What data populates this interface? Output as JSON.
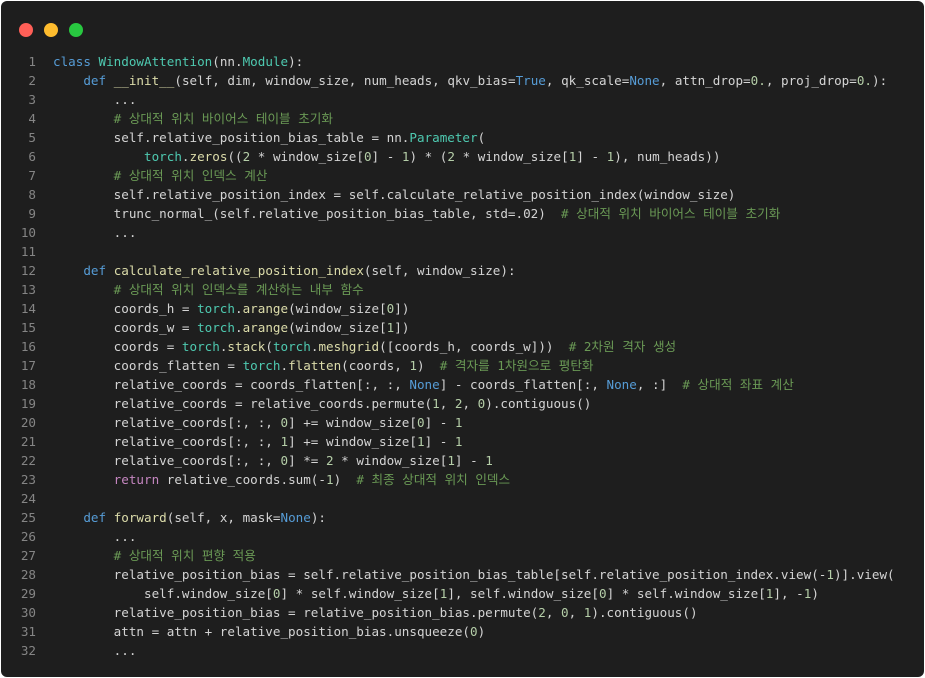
{
  "window": {
    "controls": [
      "close",
      "minimize",
      "maximize"
    ],
    "colors": {
      "close": "#ff5f57",
      "minimize": "#febc2e",
      "maximize": "#28c840",
      "background": "#1e1e1e"
    }
  },
  "language": "python",
  "lines": [
    {
      "n": "1",
      "tokens": [
        [
          "kw",
          "class "
        ],
        [
          "cls",
          "WindowAttention"
        ],
        [
          "pl",
          "(nn."
        ],
        [
          "cls",
          "Module"
        ],
        [
          "pl",
          "):"
        ]
      ]
    },
    {
      "n": "2",
      "tokens": [
        [
          "pl",
          "    "
        ],
        [
          "kw",
          "def "
        ],
        [
          "fn",
          "__init__"
        ],
        [
          "pl",
          "(self, dim, window_size, num_heads, qkv_bias="
        ],
        [
          "kw",
          "True"
        ],
        [
          "pl",
          ", qk_scale="
        ],
        [
          "kw",
          "None"
        ],
        [
          "pl",
          ", attn_drop="
        ],
        [
          "num",
          "0."
        ],
        [
          "pl",
          ", proj_drop="
        ],
        [
          "num",
          "0."
        ],
        [
          "pl",
          "):"
        ]
      ]
    },
    {
      "n": "3",
      "tokens": [
        [
          "pl",
          "        ..."
        ]
      ]
    },
    {
      "n": "4",
      "tokens": [
        [
          "pl",
          "        "
        ],
        [
          "cm",
          "# 상대적 위치 바이어스 테이블 초기화"
        ]
      ]
    },
    {
      "n": "5",
      "tokens": [
        [
          "pl",
          "        self.relative_position_bias_table = nn."
        ],
        [
          "cls",
          "Parameter"
        ],
        [
          "pl",
          "("
        ]
      ]
    },
    {
      "n": "6",
      "tokens": [
        [
          "pl",
          "            "
        ],
        [
          "cls",
          "torch"
        ],
        [
          "pl",
          "."
        ],
        [
          "fn",
          "zeros"
        ],
        [
          "pl",
          "(("
        ],
        [
          "num",
          "2"
        ],
        [
          "pl",
          " * window_size["
        ],
        [
          "num",
          "0"
        ],
        [
          "pl",
          "] - "
        ],
        [
          "num",
          "1"
        ],
        [
          "pl",
          ") * ("
        ],
        [
          "num",
          "2"
        ],
        [
          "pl",
          " * window_size["
        ],
        [
          "num",
          "1"
        ],
        [
          "pl",
          "] - "
        ],
        [
          "num",
          "1"
        ],
        [
          "pl",
          "), num_heads))"
        ]
      ]
    },
    {
      "n": "7",
      "tokens": [
        [
          "pl",
          "        "
        ],
        [
          "cm",
          "# 상대적 위치 인덱스 계산"
        ]
      ]
    },
    {
      "n": "8",
      "tokens": [
        [
          "pl",
          "        self.relative_position_index = self.calculate_relative_position_index(window_size)"
        ]
      ]
    },
    {
      "n": "9",
      "tokens": [
        [
          "pl",
          "        trunc_normal_(self.relative_position_bias_table, std=.02)  "
        ],
        [
          "cm",
          "# 상대적 위치 바이어스 테이블 초기화"
        ]
      ]
    },
    {
      "n": "10",
      "tokens": [
        [
          "pl",
          "        ..."
        ]
      ]
    },
    {
      "n": "11",
      "tokens": []
    },
    {
      "n": "12",
      "tokens": [
        [
          "pl",
          "    "
        ],
        [
          "kw",
          "def "
        ],
        [
          "fn",
          "calculate_relative_position_index"
        ],
        [
          "pl",
          "(self, window_size):"
        ]
      ]
    },
    {
      "n": "13",
      "tokens": [
        [
          "pl",
          "        "
        ],
        [
          "cm",
          "# 상대적 위치 인덱스를 계산하는 내부 함수"
        ]
      ]
    },
    {
      "n": "14",
      "tokens": [
        [
          "pl",
          "        coords_h = "
        ],
        [
          "cls",
          "torch"
        ],
        [
          "pl",
          "."
        ],
        [
          "fn",
          "arange"
        ],
        [
          "pl",
          "(window_size["
        ],
        [
          "num",
          "0"
        ],
        [
          "pl",
          "])"
        ]
      ]
    },
    {
      "n": "15",
      "tokens": [
        [
          "pl",
          "        coords_w = "
        ],
        [
          "cls",
          "torch"
        ],
        [
          "pl",
          "."
        ],
        [
          "fn",
          "arange"
        ],
        [
          "pl",
          "(window_size["
        ],
        [
          "num",
          "1"
        ],
        [
          "pl",
          "])"
        ]
      ]
    },
    {
      "n": "16",
      "tokens": [
        [
          "pl",
          "        coords = "
        ],
        [
          "cls",
          "torch"
        ],
        [
          "pl",
          "."
        ],
        [
          "fn",
          "stack"
        ],
        [
          "pl",
          "("
        ],
        [
          "cls",
          "torch"
        ],
        [
          "pl",
          "."
        ],
        [
          "fn",
          "meshgrid"
        ],
        [
          "pl",
          "([coords_h, coords_w]))  "
        ],
        [
          "cm",
          "# 2차원 격자 생성"
        ]
      ]
    },
    {
      "n": "17",
      "tokens": [
        [
          "pl",
          "        coords_flatten = "
        ],
        [
          "cls",
          "torch"
        ],
        [
          "pl",
          "."
        ],
        [
          "fn",
          "flatten"
        ],
        [
          "pl",
          "(coords, "
        ],
        [
          "num",
          "1"
        ],
        [
          "pl",
          ")  "
        ],
        [
          "cm",
          "# 격자를 1차원으로 평탄화"
        ]
      ]
    },
    {
      "n": "18",
      "tokens": [
        [
          "pl",
          "        relative_coords = coords_flatten[:, :, "
        ],
        [
          "kw",
          "None"
        ],
        [
          "pl",
          "] - coords_flatten[:, "
        ],
        [
          "kw",
          "None"
        ],
        [
          "pl",
          ", :]  "
        ],
        [
          "cm",
          "# 상대적 좌표 계산"
        ]
      ]
    },
    {
      "n": "19",
      "tokens": [
        [
          "pl",
          "        relative_coords = relative_coords.permute("
        ],
        [
          "num",
          "1"
        ],
        [
          "pl",
          ", "
        ],
        [
          "num",
          "2"
        ],
        [
          "pl",
          ", "
        ],
        [
          "num",
          "0"
        ],
        [
          "pl",
          ").contiguous()"
        ]
      ]
    },
    {
      "n": "20",
      "tokens": [
        [
          "pl",
          "        relative_coords[:, :, "
        ],
        [
          "num",
          "0"
        ],
        [
          "pl",
          "] += window_size["
        ],
        [
          "num",
          "0"
        ],
        [
          "pl",
          "] - "
        ],
        [
          "num",
          "1"
        ]
      ]
    },
    {
      "n": "21",
      "tokens": [
        [
          "pl",
          "        relative_coords[:, :, "
        ],
        [
          "num",
          "1"
        ],
        [
          "pl",
          "] += window_size["
        ],
        [
          "num",
          "1"
        ],
        [
          "pl",
          "] - "
        ],
        [
          "num",
          "1"
        ]
      ]
    },
    {
      "n": "22",
      "tokens": [
        [
          "pl",
          "        relative_coords[:, :, "
        ],
        [
          "num",
          "0"
        ],
        [
          "pl",
          "] *= "
        ],
        [
          "num",
          "2"
        ],
        [
          "pl",
          " * window_size["
        ],
        [
          "num",
          "1"
        ],
        [
          "pl",
          "] - "
        ],
        [
          "num",
          "1"
        ]
      ]
    },
    {
      "n": "23",
      "tokens": [
        [
          "pl",
          "        "
        ],
        [
          "ret",
          "return "
        ],
        [
          "pl",
          "relative_coords.sum(-"
        ],
        [
          "num",
          "1"
        ],
        [
          "pl",
          ")  "
        ],
        [
          "cm",
          "# 최종 상대적 위치 인덱스"
        ]
      ]
    },
    {
      "n": "24",
      "tokens": []
    },
    {
      "n": "25",
      "tokens": [
        [
          "pl",
          "    "
        ],
        [
          "kw",
          "def "
        ],
        [
          "fn",
          "forward"
        ],
        [
          "pl",
          "(self, x, mask="
        ],
        [
          "kw",
          "None"
        ],
        [
          "pl",
          "):"
        ]
      ]
    },
    {
      "n": "26",
      "tokens": [
        [
          "pl",
          "        ..."
        ]
      ]
    },
    {
      "n": "27",
      "tokens": [
        [
          "pl",
          "        "
        ],
        [
          "cm",
          "# 상대적 위치 편향 적용"
        ]
      ]
    },
    {
      "n": "28",
      "tokens": [
        [
          "pl",
          "        relative_position_bias = self.relative_position_bias_table[self.relative_position_index.view(-"
        ],
        [
          "num",
          "1"
        ],
        [
          "pl",
          ")].view("
        ]
      ]
    },
    {
      "n": "29",
      "tokens": [
        [
          "pl",
          "            self.window_size["
        ],
        [
          "num",
          "0"
        ],
        [
          "pl",
          "] * self.window_size["
        ],
        [
          "num",
          "1"
        ],
        [
          "pl",
          "], self.window_size["
        ],
        [
          "num",
          "0"
        ],
        [
          "pl",
          "] * self.window_size["
        ],
        [
          "num",
          "1"
        ],
        [
          "pl",
          "], -"
        ],
        [
          "num",
          "1"
        ],
        [
          "pl",
          ")"
        ]
      ]
    },
    {
      "n": "30",
      "tokens": [
        [
          "pl",
          "        relative_position_bias = relative_position_bias.permute("
        ],
        [
          "num",
          "2"
        ],
        [
          "pl",
          ", "
        ],
        [
          "num",
          "0"
        ],
        [
          "pl",
          ", "
        ],
        [
          "num",
          "1"
        ],
        [
          "pl",
          ").contiguous()"
        ]
      ]
    },
    {
      "n": "31",
      "tokens": [
        [
          "pl",
          "        attn = attn + relative_position_bias.unsqueeze("
        ],
        [
          "num",
          "0"
        ],
        [
          "pl",
          ")"
        ]
      ]
    },
    {
      "n": "32",
      "tokens": [
        [
          "pl",
          "        ..."
        ]
      ]
    }
  ]
}
